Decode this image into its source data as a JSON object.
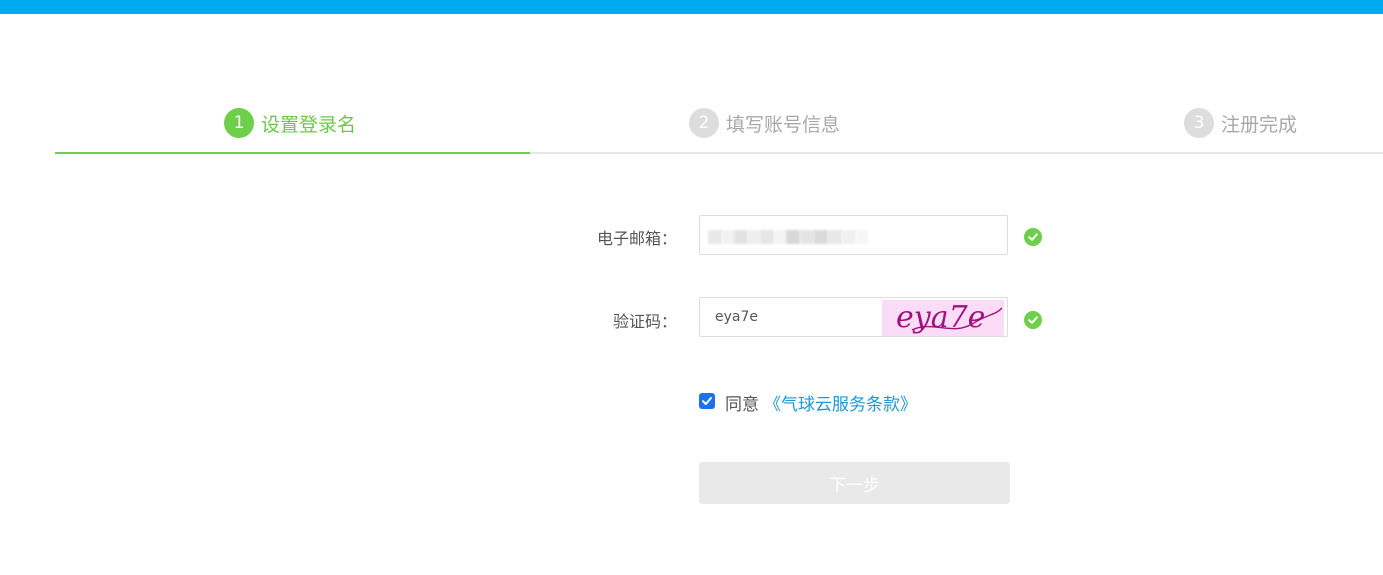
{
  "steps": [
    {
      "num": "1",
      "label": "设置登录名",
      "state": "active"
    },
    {
      "num": "2",
      "label": "填写账号信息",
      "state": "pending"
    },
    {
      "num": "3",
      "label": "注册完成",
      "state": "pending"
    }
  ],
  "form": {
    "email": {
      "label": "电子邮箱：",
      "value": "",
      "redacted": true,
      "valid": true
    },
    "captcha": {
      "label": "验证码：",
      "value": "eya7e",
      "image_text": "eya7e",
      "valid": true
    },
    "agree": {
      "checked": true,
      "text": "同意",
      "link_text": "《气球云服务条款》"
    },
    "next_button": "下一步"
  },
  "colors": {
    "top_bar": "#00aaee",
    "active_green": "#6dcf4a",
    "link_blue": "#1e9ad6",
    "captcha_ink": "#a0127e",
    "captcha_bg": "#fbdcf6"
  },
  "icons": {
    "valid": "check-circle-icon",
    "checkbox": "checkbox-checked-icon"
  }
}
